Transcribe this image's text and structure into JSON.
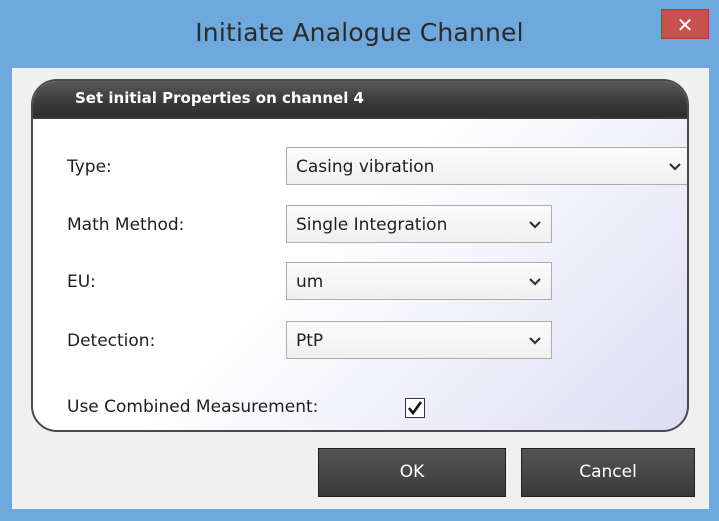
{
  "window": {
    "title": "Initiate Analogue Channel",
    "close_glyph": "✕"
  },
  "group": {
    "header": "Set initial Properties on channel 4"
  },
  "fields": {
    "type": {
      "label": "Type:",
      "value": "Casing vibration"
    },
    "math_method": {
      "label": "Math Method:",
      "value": "Single Integration"
    },
    "eu": {
      "label": "EU:",
      "value": "um"
    },
    "detection": {
      "label": "Detection:",
      "value": "PtP"
    },
    "combined": {
      "label": "Use Combined Measurement:",
      "checked": true
    }
  },
  "buttons": {
    "ok": "OK",
    "cancel": "Cancel"
  },
  "colors": {
    "title_bar": "#6ea8dc",
    "close_button": "#c75050",
    "group_header": "#3c3c3c",
    "button": "#454545"
  }
}
